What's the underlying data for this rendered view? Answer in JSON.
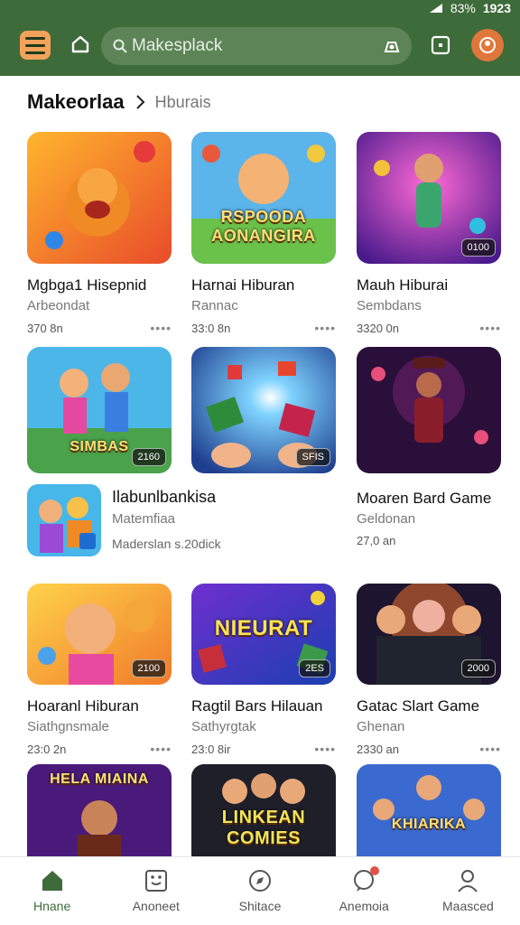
{
  "status_bar": {
    "battery": "83%",
    "time": "1923"
  },
  "app_bar": {
    "search_text": "Makesplack",
    "icons": [
      "menu-icon",
      "home-icon",
      "search-icon",
      "camera-icon",
      "box-icon",
      "profile-icon"
    ]
  },
  "section": {
    "title": "Makeorlaa",
    "subtitle": "Hburais"
  },
  "row1": [
    {
      "title": "Mgbga1 Hisepnid",
      "subtitle": "Arbeondat",
      "meta": "370 8n",
      "badge": "",
      "art_text": ""
    },
    {
      "title": "Harnai Hiburan",
      "subtitle": "Rannac",
      "meta": "33:0 8n",
      "badge": "",
      "art_text": "RSPOODA AONANGIRA"
    },
    {
      "title": "Mauh Hiburai",
      "subtitle": "Sembdans",
      "meta": "3320 0n",
      "badge": "0100",
      "art_text": ""
    }
  ],
  "row2": [
    {
      "badge": "2160",
      "art_text": "SIMBAS"
    },
    {
      "badge": "SFIS",
      "art_text": ""
    },
    {
      "title": "Moaren Bard Game",
      "subtitle": "Geldonan",
      "meta": "27,0 an",
      "badge": "",
      "art_text": ""
    }
  ],
  "promo": {
    "title": "Ilabunlbankisa",
    "subtitle": "Matemfiaa",
    "meta": "Maderslan s.20dick"
  },
  "row3": [
    {
      "title": "Hoaranl Hiburan",
      "subtitle": "Siathgnsmale",
      "meta": "23:0 2n",
      "badge": "2100",
      "art_text": ""
    },
    {
      "title": "Ragtil Bars Hilauan",
      "subtitle": "Sathyrgtak",
      "meta": "23:0 8ir",
      "badge": "2ES",
      "art_text": "NIEURAT"
    },
    {
      "title": "Gatac Slart Game",
      "subtitle": "Ghenan",
      "meta": "2330 an",
      "badge": "2000",
      "art_text": ""
    }
  ],
  "row4": [
    {
      "art_text": "HELA MIAINA"
    },
    {
      "art_text": "LINKEAN COMIES"
    },
    {
      "art_text": "KHIARIKA"
    }
  ],
  "bottom_nav": [
    {
      "label": "Hnane",
      "icon": "home-icon"
    },
    {
      "label": "Anoneet",
      "icon": "games-icon"
    },
    {
      "label": "Shitace",
      "icon": "explore-icon"
    },
    {
      "label": "Anemoia",
      "icon": "chat-icon"
    },
    {
      "label": "Maasced",
      "icon": "profile-icon"
    }
  ],
  "colors": {
    "appbar": "#3e6b3a",
    "accent_orange": "#f4a259",
    "nav_active": "#3e6b3a"
  }
}
